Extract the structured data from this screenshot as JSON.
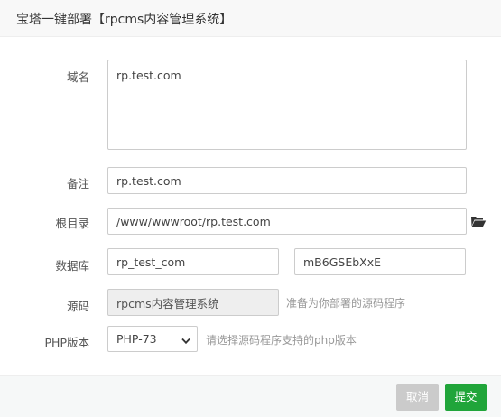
{
  "dialog": {
    "title": "宝塔一键部署【rpcms内容管理系统】"
  },
  "form": {
    "domain": {
      "label": "域名",
      "value": "rp.test.com"
    },
    "remark": {
      "label": "备注",
      "value": "rp.test.com"
    },
    "root_dir": {
      "label": "根目录",
      "value": "/www/wwwroot/rp.test.com",
      "browse_icon": "folder-open-icon"
    },
    "database": {
      "label": "数据库",
      "name_value": "rp_test_com",
      "password_value": "mB6GSEbXxE"
    },
    "source": {
      "label": "源码",
      "value": "rpcms内容管理系统",
      "hint": "准备为你部署的源码程序"
    },
    "php_version": {
      "label": "PHP版本",
      "selected": "PHP-73",
      "hint": "请选择源码程序支持的php版本"
    }
  },
  "footer": {
    "cancel_label": "取消",
    "submit_label": "提交"
  },
  "colors": {
    "accent": "#20a53a",
    "disabled_button": "#cbcbcb",
    "icon": "#333333"
  }
}
